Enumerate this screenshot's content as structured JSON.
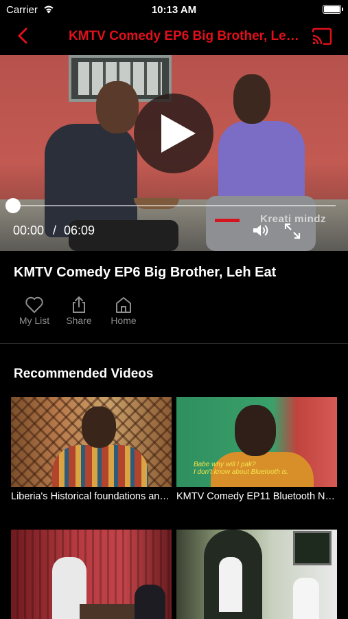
{
  "status_bar": {
    "carrier": "Carrier",
    "time": "10:13 AM"
  },
  "nav": {
    "title": "KMTV Comedy EP6 Big Brother, Leh Eat",
    "accent_color": "#e1101b"
  },
  "player": {
    "current_time": "00:00",
    "separator": "/",
    "duration": "06:09",
    "progress": 0,
    "watermark": "Kreati   mindz"
  },
  "video": {
    "title": "KMTV Comedy EP6 Big Brother, Leh Eat"
  },
  "actions": {
    "my_list": "My List",
    "share": "Share",
    "home": "Home"
  },
  "recommended": {
    "heading": "Recommended Videos",
    "items": [
      {
        "title": "Liberia's Historical foundations and Mo"
      },
      {
        "title": "KMTV Comedy EP11  Bluetooth Nah Na",
        "subtitle_line1": "Babe why will I pak?",
        "subtitle_line2": "I don't know about Bluetooth is."
      },
      {
        "title": ""
      },
      {
        "title": ""
      }
    ]
  }
}
